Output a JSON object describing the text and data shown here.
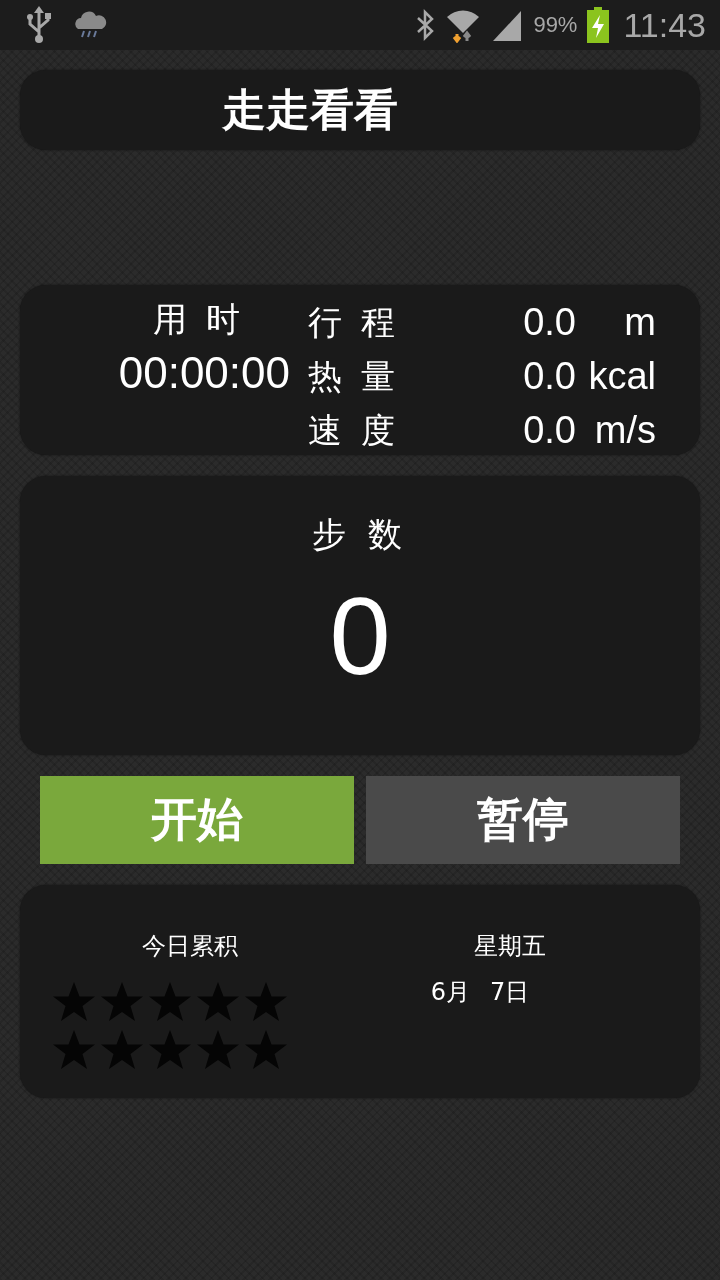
{
  "status_bar": {
    "battery_percent": "99%",
    "time": "11:43"
  },
  "title": "走走看看",
  "stats": {
    "time_label": "用 时",
    "time_value": "00:00:00",
    "rows": [
      {
        "label": "行 程",
        "value": "0.0",
        "unit": "m"
      },
      {
        "label": "热 量",
        "value": "0.0",
        "unit": "kcal"
      },
      {
        "label": "速 度",
        "value": "0.0",
        "unit": "m/s"
      }
    ]
  },
  "steps": {
    "label": "步 数",
    "value": "0"
  },
  "buttons": [
    {
      "label": "开始",
      "selected": true
    },
    {
      "label": "暂停",
      "selected": false
    }
  ],
  "summary": {
    "label": "今日累积",
    "star_rows": [
      {
        "stars": 0
      },
      {
        "stars": 0
      }
    ],
    "weekday": "星期五",
    "month": "6月",
    "day": "7日"
  }
}
